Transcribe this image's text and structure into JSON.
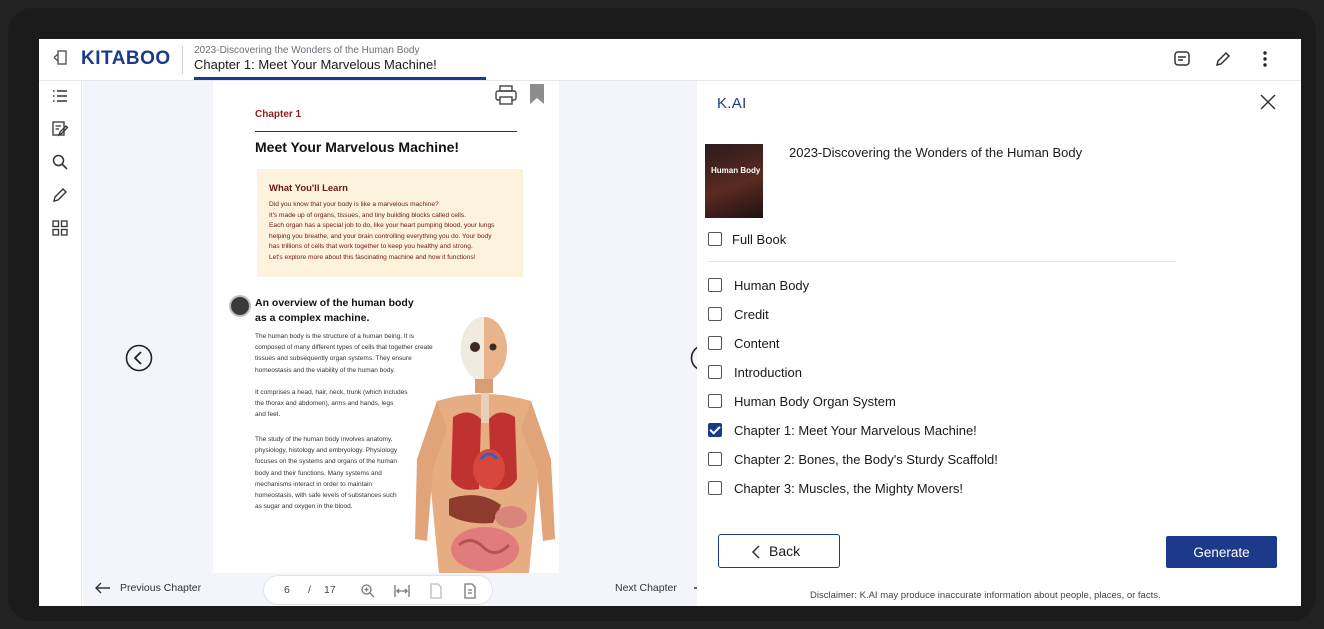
{
  "header": {
    "logo": "KITABOO",
    "book_subtitle": "2023-Discovering the Wonders of the Human Body",
    "chapter_title": "Chapter 1: Meet Your Marvelous Machine!"
  },
  "page": {
    "chapter_label": "Chapter 1",
    "title": "Meet Your Marvelous Machine!",
    "learn_title": "What You'll Learn",
    "learn_lines": [
      "Did you know that your body is like a marvelous machine?",
      "It's made up of organs, tissues, and tiny building blocks called cells.",
      "Each organ has a special job to do, like your heart pumping blood, your lungs",
      "helping you breathe, and your brain controlling everything you do. Your body",
      "has trillions of cells that work together to keep you healthy and strong.",
      "Let's explore more about this fascinating machine and how it functions!"
    ],
    "overview_line1": "An overview of the human body",
    "overview_line2": "as a complex machine.",
    "para1": [
      "The human body is the structure of a human being. It is",
      "composed of many different types of cells that together create",
      "tissues and subsequently organ systems. They ensure",
      "homeostasis and the viability of the human body."
    ],
    "para2": [
      "It comprises a head, hair, neck, trunk (which includes",
      "the thorax and abdomen), arms and hands, legs",
      "and feet."
    ],
    "para3": [
      "The study of the human body involves anatomy,",
      "physiology, histology and embryology. Physiology",
      "focuses on the systems and organs of the human",
      "body and their functions. Many systems and",
      "mechanisms interact in order to maintain",
      "homeostasis, with safe levels of substances such",
      "as sugar and oxygen in the blood."
    ]
  },
  "reader_nav": {
    "prev_chapter": "Previous Chapter",
    "next_chapter": "Next Chapter",
    "current_page": "6",
    "separator": "/",
    "total_pages": "17"
  },
  "kai": {
    "title": "K.AI",
    "cover_text": "Human Body",
    "book_name": "2023-Discovering the Wonders of the Human Body",
    "full_book": "Full Book",
    "sections": [
      {
        "label": "Human Body",
        "checked": false
      },
      {
        "label": "Credit",
        "checked": false
      },
      {
        "label": "Content",
        "checked": false
      },
      {
        "label": "Introduction",
        "checked": false
      },
      {
        "label": "Human Body Organ System",
        "checked": false
      },
      {
        "label": "Chapter 1: Meet Your Marvelous Machine!",
        "checked": true
      },
      {
        "label": "Chapter 2: Bones, the Body's Sturdy Scaffold!",
        "checked": false
      },
      {
        "label": "Chapter 3: Muscles, the Mighty Movers!",
        "checked": false
      }
    ],
    "back_label": "Back",
    "generate_label": "Generate",
    "disclaimer": "Disclaimer: K.AI may produce inaccurate information about people, places, or facts."
  },
  "colors": {
    "brand": "#1d3a8a",
    "reader_bg": "#f3f5fa",
    "learn_box": "#fdf3dd",
    "learn_text": "#6e1616"
  },
  "icons": {
    "header": [
      "back-to-library-icon",
      "notes-icon",
      "pen-icon",
      "more-vertical-icon"
    ],
    "rail": [
      "toc-icon",
      "edit-notes-icon",
      "search-icon",
      "highlight-pen-icon",
      "grid-icon"
    ],
    "page": [
      "print-icon",
      "bookmark-icon"
    ],
    "pager": [
      "zoom-in-icon",
      "fit-width-icon",
      "single-page-icon",
      "page-settings-icon"
    ]
  }
}
